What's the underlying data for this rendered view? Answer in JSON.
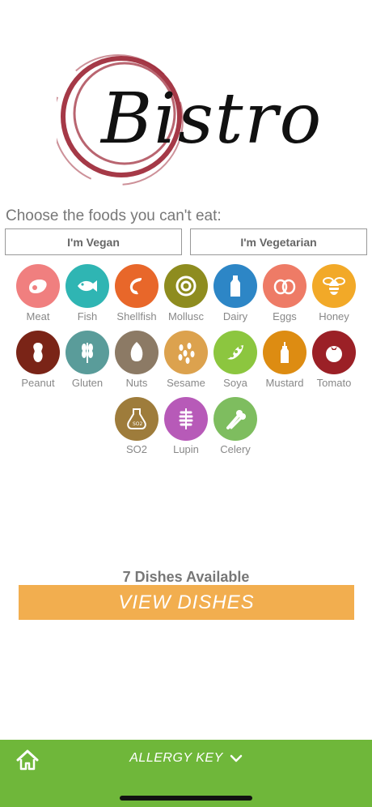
{
  "logo": {
    "text": "Bistro",
    "ring_color": "#9b2433"
  },
  "prompt": "Choose the foods you can't eat:",
  "diet_buttons": {
    "vegan": "I'm Vegan",
    "vegetarian": "I'm Vegetarian"
  },
  "allergens": [
    {
      "label": "Meat",
      "color": "#f07f7f",
      "icon": "meat-icon"
    },
    {
      "label": "Fish",
      "color": "#2fb5b3",
      "icon": "fish-icon"
    },
    {
      "label": "Shellfish",
      "color": "#e8672a",
      "icon": "shrimp-icon"
    },
    {
      "label": "Mollusc",
      "color": "#8e8c1f",
      "icon": "snail-icon"
    },
    {
      "label": "Dairy",
      "color": "#2d86c6",
      "icon": "milk-bottle-icon"
    },
    {
      "label": "Eggs",
      "color": "#ee7b66",
      "icon": "eggs-icon"
    },
    {
      "label": "Honey",
      "color": "#f2a928",
      "icon": "bee-icon"
    },
    {
      "label": "Peanut",
      "color": "#7a2417",
      "icon": "peanut-icon"
    },
    {
      "label": "Gluten",
      "color": "#5a9c9a",
      "icon": "wheat-icon"
    },
    {
      "label": "Nuts",
      "color": "#8c7a65",
      "icon": "almond-icon"
    },
    {
      "label": "Sesame",
      "color": "#dca24e",
      "icon": "sesame-icon"
    },
    {
      "label": "Soya",
      "color": "#8cc63f",
      "icon": "soy-pod-icon"
    },
    {
      "label": "Mustard",
      "color": "#dd8c12",
      "icon": "mustard-bottle-icon"
    },
    {
      "label": "Tomato",
      "color": "#9b2026",
      "icon": "tomato-icon"
    },
    {
      "label": "SO2",
      "color": "#9e7c3b",
      "icon": "so2-flask-icon"
    },
    {
      "label": "Lupin",
      "color": "#b75ab8",
      "icon": "lupin-icon"
    },
    {
      "label": "Celery",
      "color": "#7ebd5f",
      "icon": "celery-icon"
    }
  ],
  "dishes_available": "7 Dishes Available",
  "view_button": "VIEW DISHES",
  "bottom_bar": {
    "allergy_key": "ALLERGY KEY",
    "accent": "#6fb73a"
  }
}
